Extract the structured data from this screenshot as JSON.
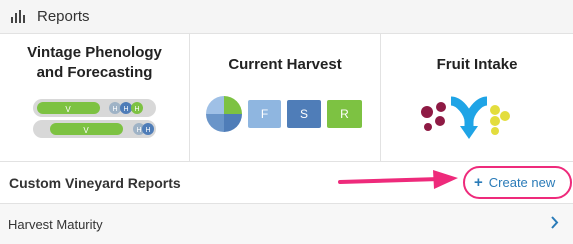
{
  "header": {
    "title": "Reports",
    "icon": "bar-chart-icon"
  },
  "cards": [
    {
      "title": "Vintage Phenology and Forecasting",
      "pills": [
        {
          "label": "V",
          "dots": [
            "H",
            "H",
            "H"
          ]
        },
        {
          "label": "V",
          "dots": [
            "H",
            "H"
          ]
        }
      ]
    },
    {
      "title": "Current Harvest",
      "buttons": [
        "F",
        "S",
        "R"
      ]
    },
    {
      "title": "Fruit Intake"
    }
  ],
  "custom": {
    "title": "Custom Vineyard Reports",
    "create_label": "Create new"
  },
  "reports": [
    {
      "label": "Harvest Maturity"
    }
  ],
  "colors": {
    "green": "#7dc242",
    "grey_pill": "#d8d8d8",
    "blue_light": "#8fb6e0",
    "blue_dark": "#4f7db8",
    "purple": "#8e1a44",
    "yellow": "#e3dd3d",
    "arrow_blue": "#1fa4e6",
    "highlight": "#ee2a7b",
    "link": "#2a7bb8"
  }
}
